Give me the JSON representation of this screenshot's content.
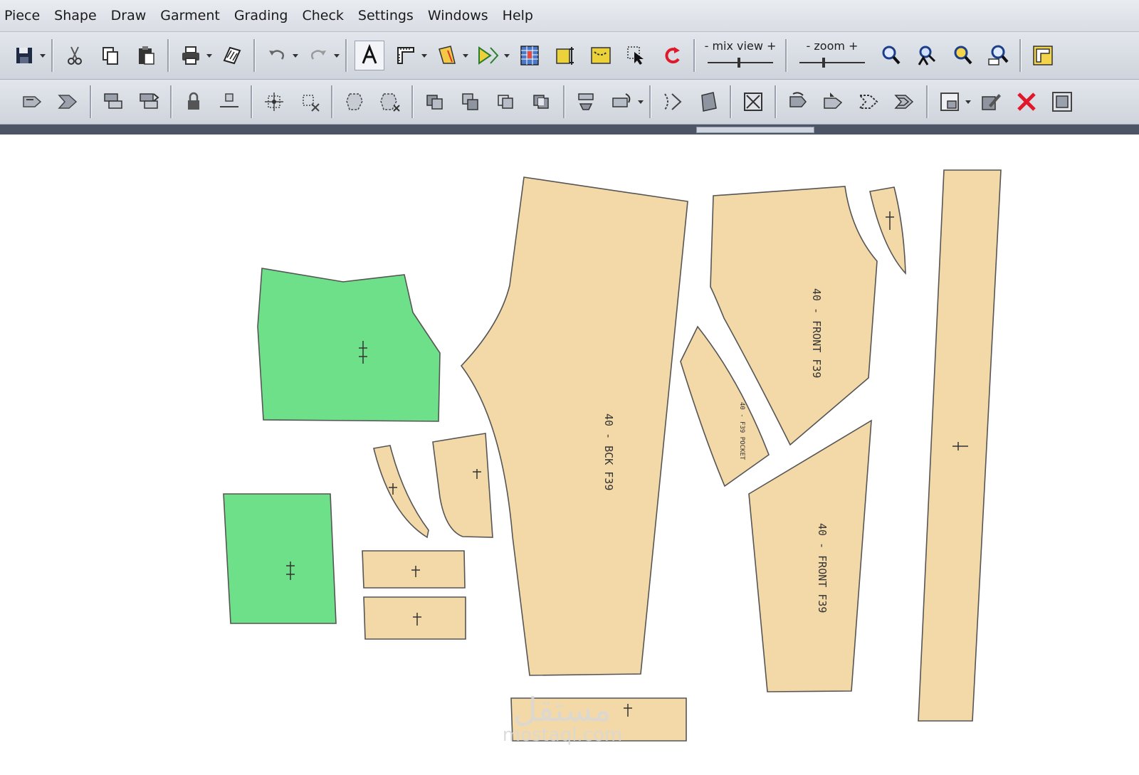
{
  "menu": {
    "items": [
      {
        "label": "Piece"
      },
      {
        "label": "Shape"
      },
      {
        "label": "Draw"
      },
      {
        "label": "Garment"
      },
      {
        "label": "Grading"
      },
      {
        "label": "Check"
      },
      {
        "label": "Settings"
      },
      {
        "label": "Windows"
      },
      {
        "label": "Help"
      }
    ]
  },
  "toolbar": {
    "mix_view_label": "- mix view +",
    "zoom_label": "- zoom +"
  },
  "colors": {
    "piece_fill": "#f3d9a8",
    "piece_fill_selected": "#6fe08a",
    "piece_outline": "#555555"
  },
  "pieces": {
    "back": {
      "label": "40 - BCK F39"
    },
    "front_upper": {
      "label": "40 - FRONT F39"
    },
    "front_lower": {
      "label": "40 - FRONT F39"
    },
    "pocket_facing": {
      "label": "40 - F39 POCKET"
    }
  },
  "watermark": {
    "arabic": "مستقل",
    "latin": "mostaql.com"
  }
}
